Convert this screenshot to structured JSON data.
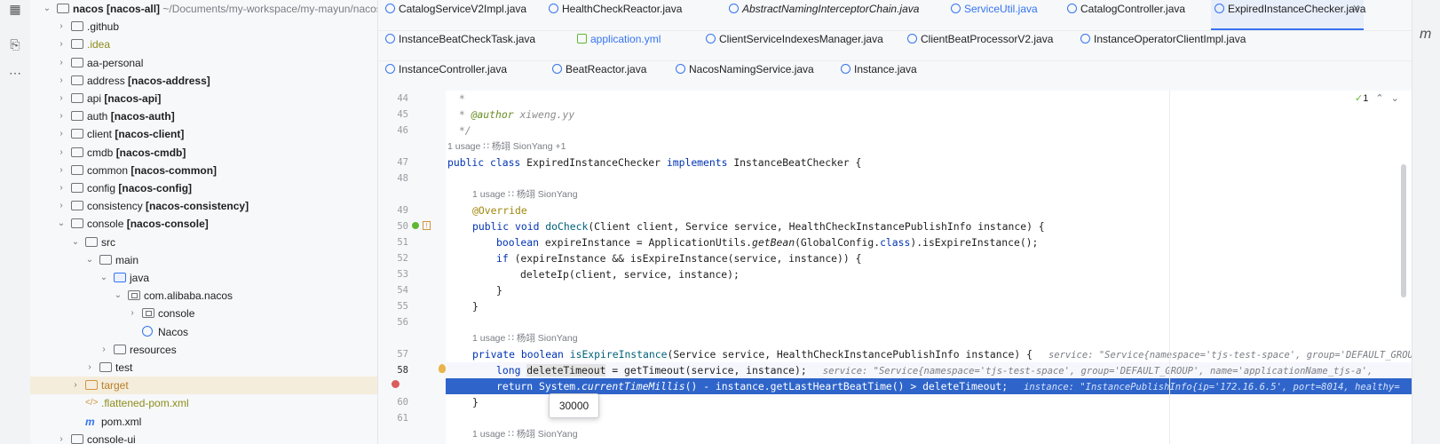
{
  "tree": {
    "rows": [
      {
        "label": "nacos [nacos-all]",
        "suffix": "~/Documents/my-workspace/my-mayun/nacos",
        "indent": 0,
        "chev": "v",
        "icon": "folder"
      },
      {
        "label": ".github",
        "indent": 1,
        "chev": ">",
        "icon": "folder"
      },
      {
        "label": ".idea",
        "indent": 1,
        "chev": ">",
        "icon": "folder",
        "style": "olive"
      },
      {
        "label": "aa-personal",
        "indent": 1,
        "chev": ">",
        "icon": "folder"
      },
      {
        "label": "address",
        "module": "[nacos-address]",
        "indent": 1,
        "chev": ">",
        "icon": "folder"
      },
      {
        "label": "api",
        "module": "[nacos-api]",
        "indent": 1,
        "chev": ">",
        "icon": "folder"
      },
      {
        "label": "auth",
        "module": "[nacos-auth]",
        "indent": 1,
        "chev": ">",
        "icon": "folder"
      },
      {
        "label": "client",
        "module": "[nacos-client]",
        "indent": 1,
        "chev": ">",
        "icon": "folder"
      },
      {
        "label": "cmdb",
        "module": "[nacos-cmdb]",
        "indent": 1,
        "chev": ">",
        "icon": "folder"
      },
      {
        "label": "common",
        "module": "[nacos-common]",
        "indent": 1,
        "chev": ">",
        "icon": "folder"
      },
      {
        "label": "config",
        "module": "[nacos-config]",
        "indent": 1,
        "chev": ">",
        "icon": "folder"
      },
      {
        "label": "consistency",
        "module": "[nacos-consistency]",
        "indent": 1,
        "chev": ">",
        "icon": "folder"
      },
      {
        "label": "console",
        "module": "[nacos-console]",
        "indent": 1,
        "chev": "v",
        "icon": "folder"
      },
      {
        "label": "src",
        "indent": 2,
        "chev": "v",
        "icon": "folder"
      },
      {
        "label": "main",
        "indent": 3,
        "chev": "v",
        "icon": "folder"
      },
      {
        "label": "java",
        "indent": 4,
        "chev": "v",
        "icon": "folder-blue"
      },
      {
        "label": "com.alibaba.nacos",
        "indent": 5,
        "chev": "v",
        "icon": "package"
      },
      {
        "label": "console",
        "indent": 6,
        "chev": ">",
        "icon": "package"
      },
      {
        "label": "Nacos",
        "indent": 6,
        "chev": "",
        "icon": "class"
      },
      {
        "label": "resources",
        "indent": 4,
        "chev": ">",
        "icon": "folder"
      },
      {
        "label": "test",
        "indent": 3,
        "chev": ">",
        "icon": "folder"
      },
      {
        "label": "target",
        "indent": 2,
        "chev": ">",
        "icon": "folder-orange",
        "style": "orange",
        "selected": true
      },
      {
        "label": ".flattened-pom.xml",
        "indent": 2,
        "chev": "",
        "icon": "xml",
        "style": "olive"
      },
      {
        "label": "pom.xml",
        "indent": 2,
        "chev": "",
        "icon": "maven"
      },
      {
        "label": "console-ui",
        "indent": 1,
        "chev": ">",
        "icon": "folder"
      }
    ]
  },
  "tabs": {
    "row1": [
      {
        "label": "CatalogServiceV2Impl.java"
      },
      {
        "label": "HealthCheckReactor.java"
      },
      {
        "label": "AbstractNamingInterceptorChain.java",
        "italic": true
      },
      {
        "label": "ServiceUtil.java",
        "blue": true
      },
      {
        "label": "CatalogController.java"
      },
      {
        "label": "ExpiredInstanceChecker.java",
        "active": true
      }
    ],
    "row2": [
      {
        "label": "InstanceBeatCheckTask.java"
      },
      {
        "label": "application.yml",
        "blue": true
      },
      {
        "label": "ClientServiceIndexesManager.java"
      },
      {
        "label": "ClientBeatProcessorV2.java"
      },
      {
        "label": "InstanceOperatorClientImpl.java"
      }
    ],
    "row3": [
      {
        "label": "InstanceController.java"
      },
      {
        "label": "BeatReactor.java"
      },
      {
        "label": "NacosNamingService.java"
      },
      {
        "label": "Instance.java"
      }
    ]
  },
  "editor": {
    "inspection_count": "1",
    "lines": {
      "l44": {
        "num": "44",
        "text": " *"
      },
      "l45": {
        "num": "45",
        "tag": " * ",
        "author_tag": "@author",
        "author": " xiweng.yy"
      },
      "l46": {
        "num": "46",
        "text": " */"
      },
      "h1": "1 usage   ∷ 杨翊 SionYang +1",
      "l47": {
        "num": "47",
        "kw1": "public class ",
        "name": "ExpiredInstanceChecker ",
        "kw2": "implements ",
        "rest": "InstanceBeatChecker {"
      },
      "l48": {
        "num": "48"
      },
      "h2": "1 usage   ∷ 杨翊 SionYang",
      "l49": {
        "num": "49",
        "text": "@Override"
      },
      "l50": {
        "num": "50",
        "kw": "public void ",
        "fn": "doCheck",
        "rest": "(Client client, Service service, HealthCheckInstancePublishInfo instance) {"
      },
      "l51": {
        "num": "51",
        "kw": "boolean ",
        "a": "expireInstance = ApplicationUtils.",
        "it": "getBean",
        "b": "(GlobalConfig.",
        "kw2": "class",
        "c": ").isExpireInstance();"
      },
      "l52": {
        "num": "52",
        "kw": "if ",
        "rest": "(expireInstance && isExpireInstance(service, instance)) {"
      },
      "l53": {
        "num": "53",
        "text": "deleteIp(client, service, instance);"
      },
      "l54": {
        "num": "54",
        "text": "}"
      },
      "l55": {
        "num": "55",
        "text": "}"
      },
      "l56": {
        "num": "56"
      },
      "h3": "1 usage   ∷ 杨翊 SionYang",
      "l57": {
        "num": "57",
        "kw": "private boolean ",
        "fn": "isExpireInstance",
        "rest": "(Service service, HealthCheckInstancePublishInfo instance) {",
        "inlay": "service: \"Service{namespace='tjs-test-space', group='DEFAULT_GROUP'"
      },
      "l58": {
        "num": "58",
        "kw": "long ",
        "var": "deleteTimeout",
        "rest": " = getTimeout(service, instance);",
        "inlay": "service: \"Service{namespace='tjs-test-space', group='DEFAULT_GROUP', name='applicationName_tjs-a',"
      },
      "l59": {
        "num": "59",
        "kw": "return ",
        "a": "System.",
        "it": "currentTimeMillis",
        "rest": "() - instance.getLastHeartBeatTime() > deleteTimeout;",
        "inlay": "instance: \"InstancePublishInfo{ip='172.16.6.5', port=8014, healthy="
      },
      "l60": {
        "num": "60",
        "text": "}"
      },
      "l61": {
        "num": "61"
      },
      "h4": "1 usage   ∷ 杨翊 SionYang"
    },
    "tooltip": "30000"
  }
}
